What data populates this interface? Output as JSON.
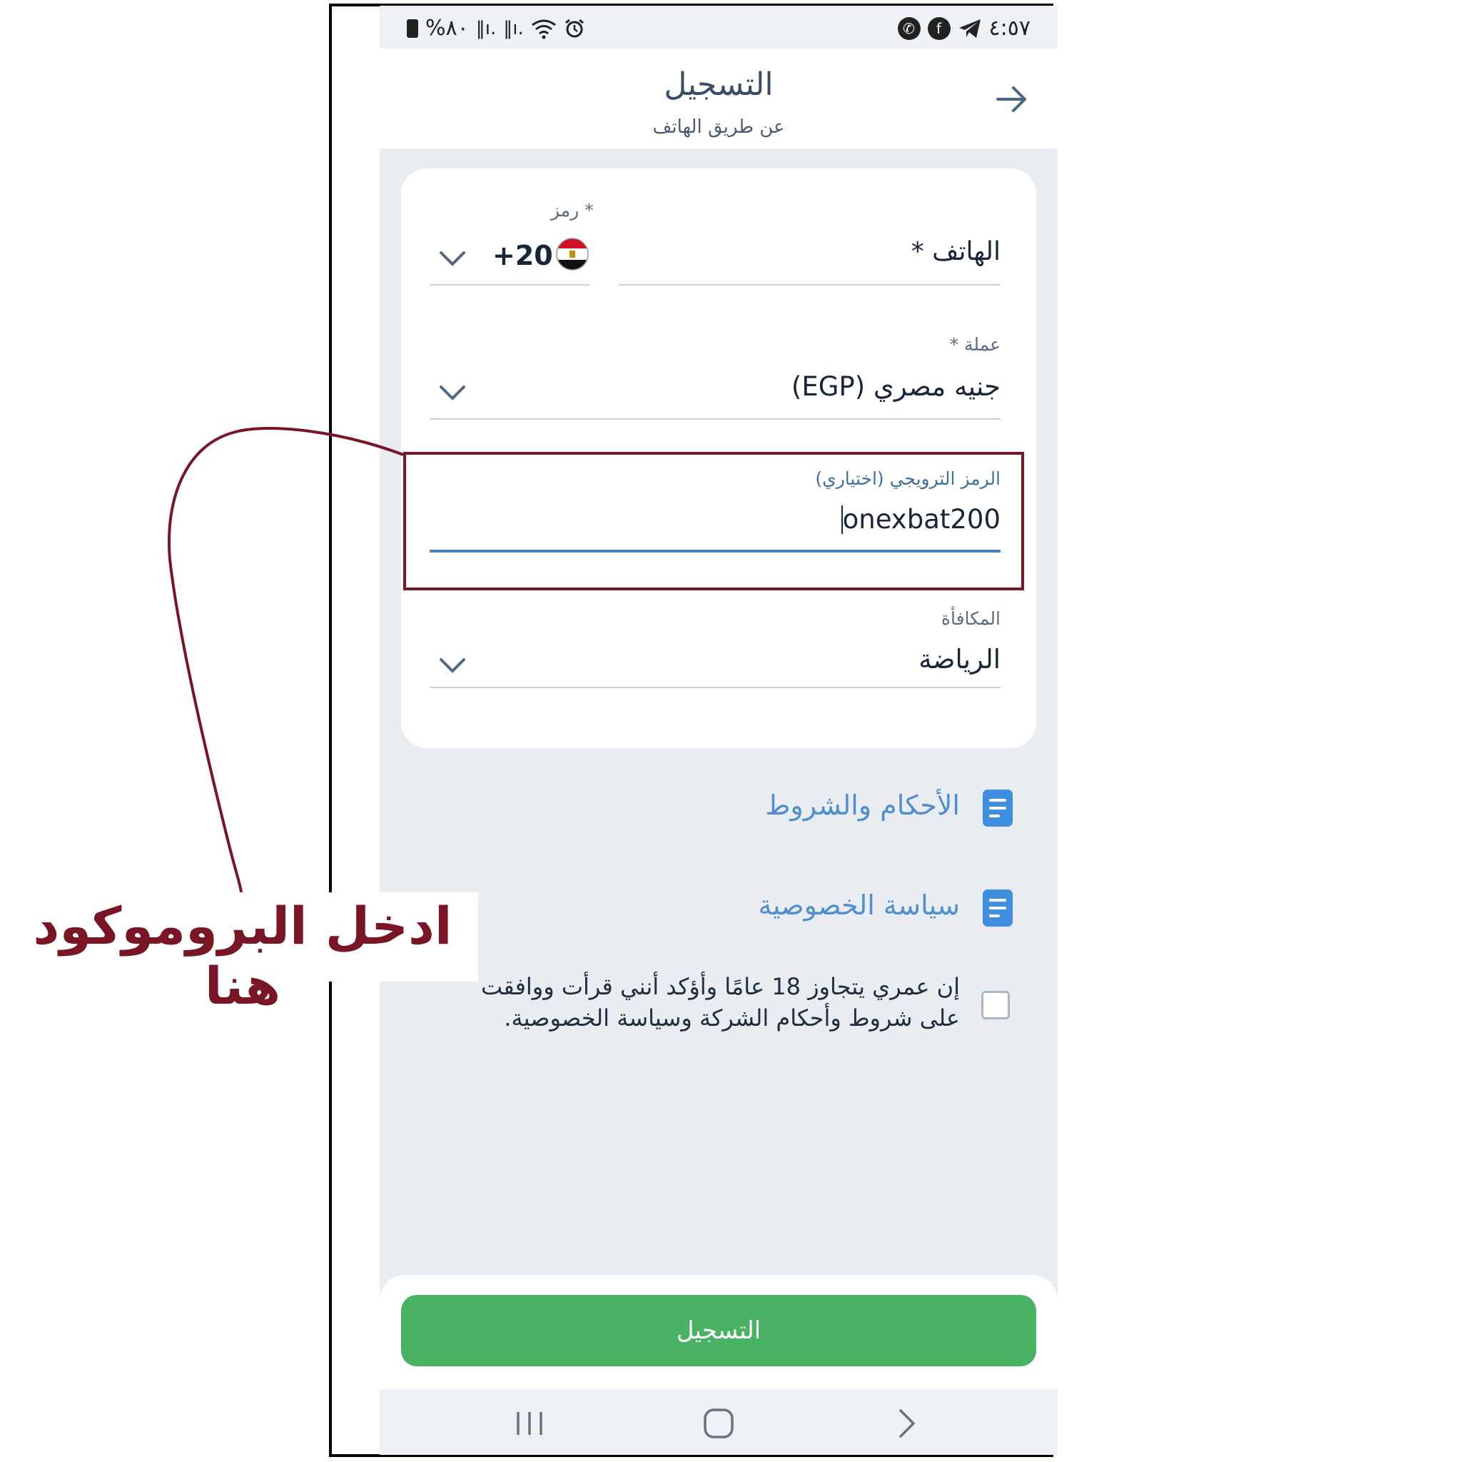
{
  "status_bar": {
    "time": "٤:٥٧",
    "battery": "%٨٠",
    "right_icons": [
      "whatsapp-icon",
      "facebook-icon",
      "telegram-icon"
    ],
    "left_icons": [
      "battery-icon",
      "signal-icon",
      "signal-icon",
      "wifi-icon",
      "alarm-icon"
    ]
  },
  "header": {
    "title": "التسجيل",
    "subtitle": "عن طريق الهاتف",
    "back_icon": "arrow-right-icon"
  },
  "form": {
    "country_code": {
      "label": "* رمز",
      "value": "+20",
      "flag_icon": "egypt-flag-icon"
    },
    "phone": {
      "label": "الهاتف *"
    },
    "currency": {
      "label": "عملة *",
      "value": "جنيه مصري (EGP)"
    },
    "promo": {
      "label": "الرمز الترويجي (اختياري)",
      "value": "onexbat200"
    },
    "bonus": {
      "label": "المكافأة",
      "value": "الرياضة"
    }
  },
  "links": {
    "terms": "الأحكام والشروط",
    "privacy": "سياسة الخصوصية"
  },
  "consent": {
    "line1": "إن عمري يتجاوز 18 عامًا وأؤكد أنني قرأت ووافقت",
    "line2": "على شروط وأحكام الشركة وسياسة الخصوصية."
  },
  "register_button": "التسجيل",
  "nav": {
    "recents": "|||",
    "home": "◯",
    "back": "›"
  },
  "annotation": {
    "text": "ادخل البروموكود هنا",
    "color": "#7a1526"
  },
  "colors": {
    "accent": "#49b263",
    "link": "#4f8fd0",
    "annotation": "#7a1526"
  }
}
